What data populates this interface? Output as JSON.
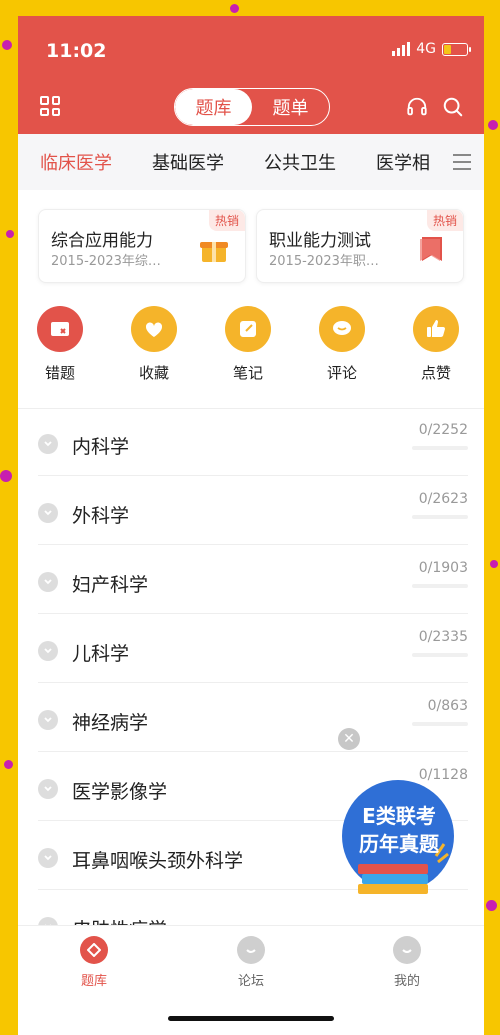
{
  "status": {
    "time": "11:02",
    "network": "4G"
  },
  "header": {
    "seg_active": "题库",
    "seg_inactive": "题单"
  },
  "categories": [
    "临床医学",
    "基础医学",
    "公共卫生",
    "医学相"
  ],
  "cards": [
    {
      "title": "综合应用能力",
      "subtitle": "2015-2023年综…",
      "badge": "热销"
    },
    {
      "title": "职业能力测试",
      "subtitle": "2015-2023年职…",
      "badge": "热销"
    }
  ],
  "shortcuts": [
    "错题",
    "收藏",
    "笔记",
    "评论",
    "点赞"
  ],
  "subjects": [
    {
      "name": "内科学",
      "count": "0/2252"
    },
    {
      "name": "外科学",
      "count": "0/2623"
    },
    {
      "name": "妇产科学",
      "count": "0/1903"
    },
    {
      "name": "儿科学",
      "count": "0/2335"
    },
    {
      "name": "神经病学",
      "count": "0/863"
    },
    {
      "name": "医学影像学",
      "count": "0/1128"
    },
    {
      "name": "耳鼻咽喉头颈外科学",
      "count": ""
    },
    {
      "name": "皮肤性病学",
      "count": ""
    }
  ],
  "promo": {
    "line1": "E类联考",
    "line2": "历年真题"
  },
  "tabs": [
    "题库",
    "论坛",
    "我的"
  ],
  "colors": {
    "accent": "#e2534a",
    "shortcut_yellow": "#f5b42a",
    "background": "#f7c600"
  }
}
